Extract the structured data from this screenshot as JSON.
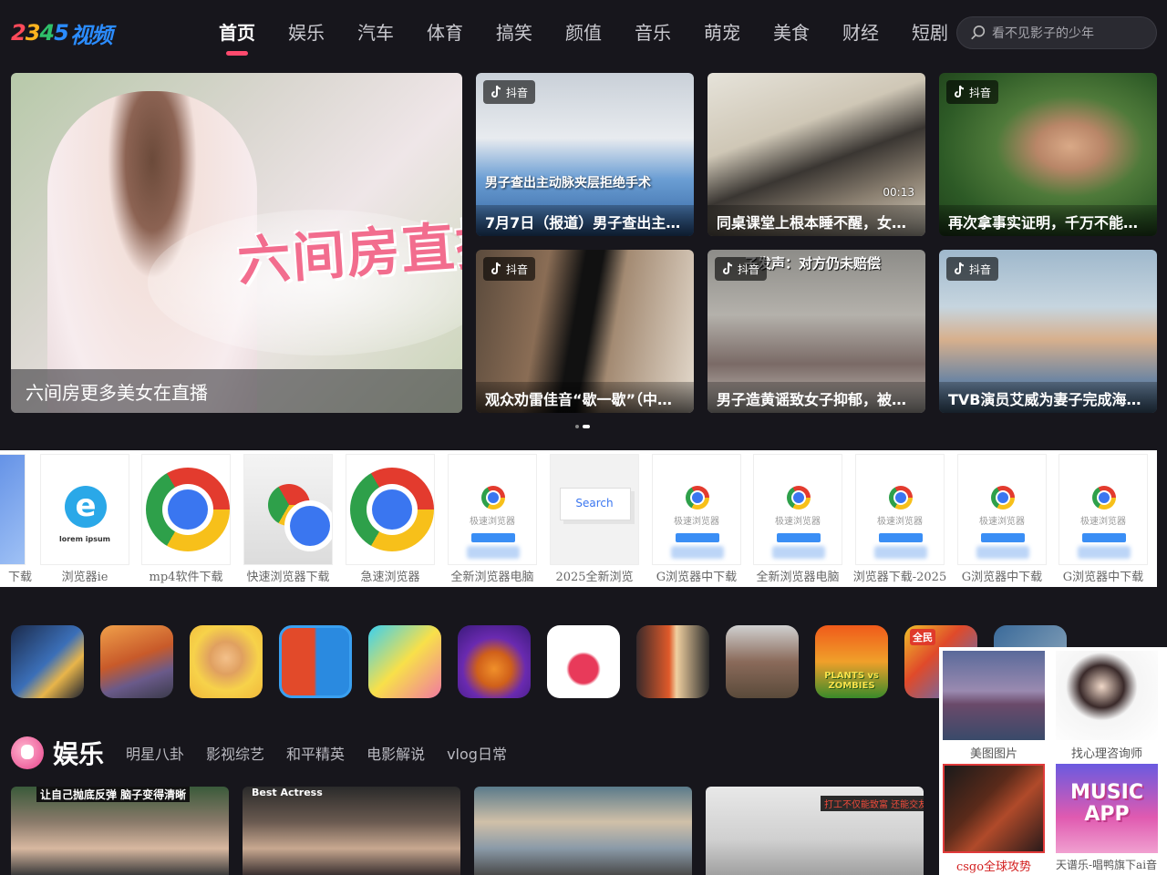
{
  "header": {
    "logo_digits": [
      "2",
      "3",
      "4",
      "5"
    ],
    "logo_text": "视频",
    "nav": [
      "首页",
      "娱乐",
      "汽车",
      "体育",
      "搞笑",
      "颜值",
      "音乐",
      "萌宠",
      "美食",
      "财经",
      "短剧"
    ],
    "active_nav": "首页",
    "search_placeholder": "看不见影子的少年"
  },
  "hero": {
    "image_text": "六间房直播",
    "caption": "六间房更多美女在直播"
  },
  "badge_label": "抖音",
  "cards": [
    {
      "caption": "7月7日（报道）男子查出主…",
      "overlay_title": "男子查出主动脉夹层拒绝手术"
    },
    {
      "caption": "同桌课堂上根本睡不醒，女…",
      "duration": "00:13"
    },
    {
      "caption": "再次拿事实证明，千万不能…"
    },
    {
      "caption": "观众劝雷佳音“歇一歇”（中…"
    },
    {
      "caption": "男子造黄谣致女子抑郁，被…",
      "top_text": "子发声：对方仍未赔偿"
    },
    {
      "caption": "TVB演员艾威为妻子完成海…"
    }
  ],
  "carousel": {
    "pages": 2,
    "active": 2
  },
  "ads": [
    {
      "label": "下载"
    },
    {
      "label": "浏览器ie",
      "img_text": "lorem ipsum"
    },
    {
      "label": "mp4软件下载"
    },
    {
      "label": "快速浏览器下载"
    },
    {
      "label": "急速浏览器"
    },
    {
      "label": "全新浏览器电脑",
      "img_text": "极速浏览器"
    },
    {
      "label": "2025全新浏览",
      "img_text": "Search"
    },
    {
      "label": "G浏览器中下载",
      "img_text": "极速浏览器"
    },
    {
      "label": "全新浏览器电脑",
      "img_text": "极速浏览器"
    },
    {
      "label": "浏览器下载-2025",
      "img_text": "极速浏览器"
    },
    {
      "label": "G浏览器中下载",
      "img_text": "极速浏览器"
    },
    {
      "label": "G浏览器中下载",
      "img_text": "极速浏览器"
    }
  ],
  "games": [
    {
      "name": "game-1"
    },
    {
      "name": "game-2"
    },
    {
      "name": "game-3"
    },
    {
      "name": "game-4"
    },
    {
      "name": "game-5"
    },
    {
      "name": "game-6"
    },
    {
      "name": "game-7"
    },
    {
      "name": "game-8"
    },
    {
      "name": "game-9"
    },
    {
      "name": "game-10",
      "text": "PLANTS vs ZOMBIES"
    },
    {
      "name": "game-11",
      "text": "全民"
    }
  ],
  "section": {
    "title": "娱乐",
    "tabs": [
      "明星八卦",
      "影视综艺",
      "和平精英",
      "电影解说",
      "vlog日常"
    ]
  },
  "bottom_cards": [
    {
      "top_text": "让自己抛底反弹 脑子变得清晰"
    },
    {
      "top_text": "Best Actress"
    },
    {},
    {
      "top_text": "打工不仅能致富 还能交友"
    }
  ],
  "side_panel": {
    "items": [
      {
        "label": "美图图片"
      },
      {
        "label": "找心理咨询师"
      },
      {
        "label": "csgo全球攻势"
      },
      {
        "label": "天谱乐-唱鸭旗下ai音",
        "img_text": "MUSIC APP"
      }
    ]
  }
}
